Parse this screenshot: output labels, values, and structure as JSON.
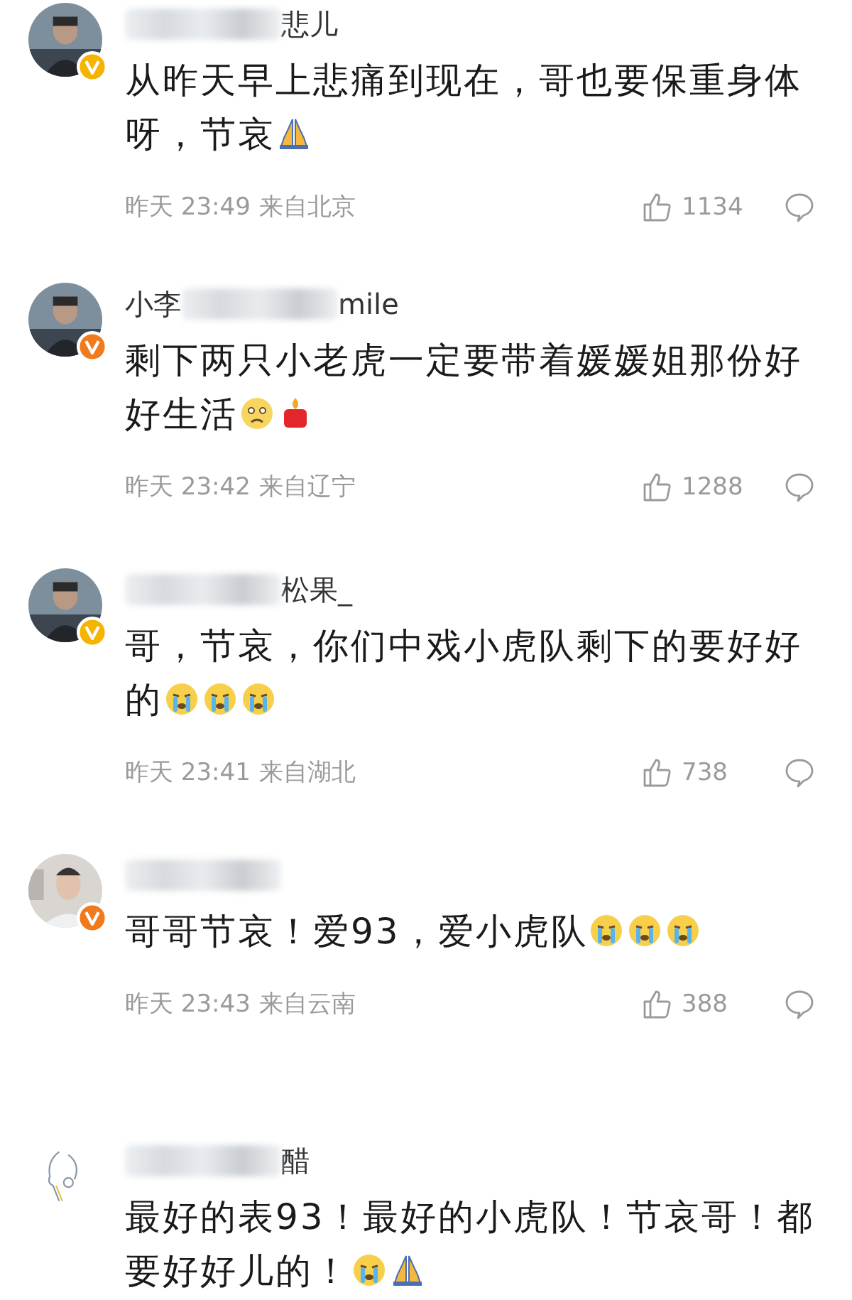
{
  "comments": [
    {
      "name_end": "悲儿",
      "color": "#f5b400",
      "text": "从昨天早上悲痛到现在，哥也要保重身体呀，节哀",
      "emojis": [
        {
          "kind": "pray"
        }
      ],
      "time": "昨天 23:49",
      "location": "来自北京",
      "likes": "1134"
    },
    {
      "name_start": "小李",
      "name_end": "mile",
      "color": "#f07a1e",
      "text": "剩下两只小老虎一定要带着媛媛姐那份好好生活",
      "emojis": [
        {
          "kind": "worried"
        },
        {
          "kind": "candle"
        }
      ],
      "time": "昨天 23:42",
      "location": "来自辽宁",
      "likes": "1288"
    },
    {
      "name_end": "松果_",
      "color": "#f5b400",
      "text": "哥，节哀，你们中戏小虎队剩下的要好好的",
      "emojis": [
        {
          "kind": "cry"
        },
        {
          "kind": "cry"
        },
        {
          "kind": "cry"
        }
      ],
      "time": "昨天 23:41",
      "location": "来自湖北",
      "likes": "738"
    },
    {
      "color": "#f07a1e",
      "text": "哥哥节哀！爱93，爱小虎队",
      "emojis": [
        {
          "kind": "cry"
        },
        {
          "kind": "cry"
        },
        {
          "kind": "cry"
        }
      ],
      "time": "昨天 23:43",
      "location": "来自云南",
      "likes": "388"
    },
    {
      "name_end": "醋",
      "text": "最好的表93！最好的小虎队！节哀哥！都要好好儿的！",
      "emojis": [
        {
          "kind": "cry"
        },
        {
          "kind": "pray"
        }
      ]
    }
  ]
}
